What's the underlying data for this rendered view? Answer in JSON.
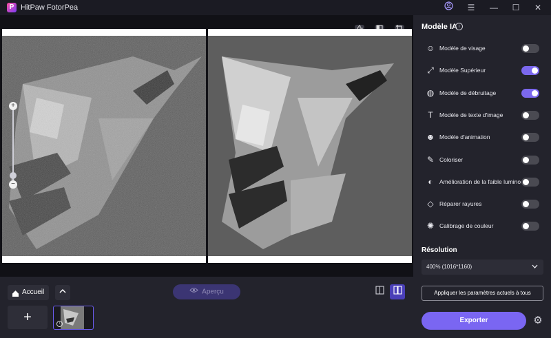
{
  "app": {
    "title": "HitPaw FotorPea",
    "logo_letter": "P"
  },
  "window": {
    "account_icon": "user-circle-icon",
    "menu_icon": "☰",
    "minimize": "—",
    "maximize": "☐",
    "close": "✕"
  },
  "panel": {
    "title": "Modèle IA",
    "models": [
      {
        "label": "Modèle de visage",
        "icon": "face-icon",
        "on": false
      },
      {
        "label": "Modèle Supérieur",
        "icon": "upscale-icon",
        "on": true
      },
      {
        "label": "Modèle de débruitage",
        "icon": "denoise-icon",
        "on": true
      },
      {
        "label": "Modèle de texte d'image",
        "icon": "text-icon",
        "on": false
      },
      {
        "label": "Modèle d'animation",
        "icon": "animation-icon",
        "on": false
      },
      {
        "label": "Coloriser",
        "icon": "colorize-icon",
        "on": false
      },
      {
        "label": "Amélioration de la faible luminosité",
        "icon": "lowlight-icon",
        "on": false
      },
      {
        "label": "Réparer rayures",
        "icon": "scratch-icon",
        "on": false
      },
      {
        "label": "Calibrage de couleur",
        "icon": "color-calibration-icon",
        "on": false
      }
    ],
    "resolution_title": "Résolution",
    "resolution_value": "400% (1016*1160)",
    "apply_label": "Appliquer les paramètres actuels à tous",
    "export_label": "Exporter"
  },
  "bottom": {
    "home_label": "Accueil",
    "preview_label": "Aperçu",
    "add_label": "+"
  },
  "colors": {
    "accent": "#7a66f2",
    "bg": "#1b1b23",
    "panel": "#23232c"
  }
}
